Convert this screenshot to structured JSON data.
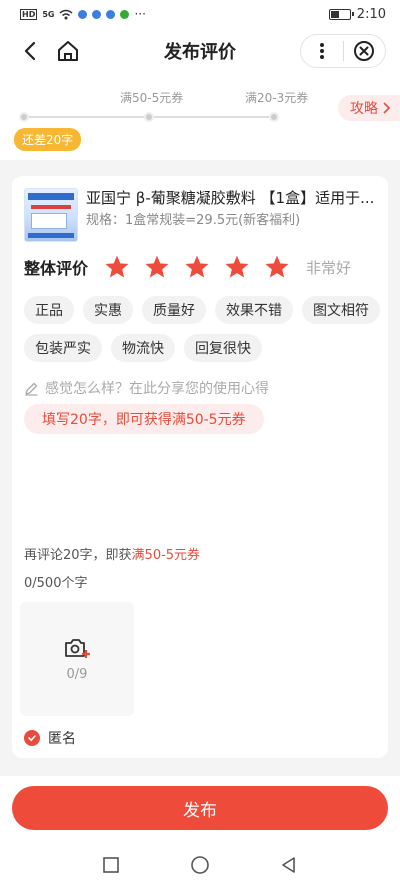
{
  "status_bar": {
    "hd": "HD",
    "signal": "5G",
    "more": "···",
    "battery_level": 0.35,
    "time": "2:10"
  },
  "nav": {
    "title": "发布评价",
    "icons": [
      "back-icon",
      "home-icon",
      "more-vertical-icon",
      "close-circle-icon"
    ]
  },
  "progress": {
    "milestone1": "满50-5元券",
    "milestone2": "满20-3元券",
    "gap_badge": "还差20字",
    "guide_button": "攻略"
  },
  "product": {
    "name": "亚国宁 β-葡聚糖凝胶敷料 【1盒】适用于...",
    "spec": "规格：1盒常规装=29.5元(新客福利)"
  },
  "rating": {
    "label": "整体评价",
    "stars": 5,
    "max_stars": 5,
    "verdict": "非常好",
    "star_color": "#ef4b3a"
  },
  "tags": [
    "正品",
    "实惠",
    "质量好",
    "效果不错",
    "图文相符",
    "包装严实",
    "物流快",
    "回复很快"
  ],
  "editor": {
    "placeholder": "感觉怎么样？在此分享您的使用心得",
    "hint": "填写20字，即可获得满50-5元券",
    "remind_prefix": "再评论20字，即获",
    "remind_coupon": "满50-5元券",
    "counter": "0/500个字"
  },
  "upload": {
    "count": "0/9"
  },
  "anonymous": {
    "label": "匿名",
    "checked": true
  },
  "submit_label": "发布",
  "colors": {
    "accent": "#ef4b3a",
    "badge": "#f7b733"
  }
}
